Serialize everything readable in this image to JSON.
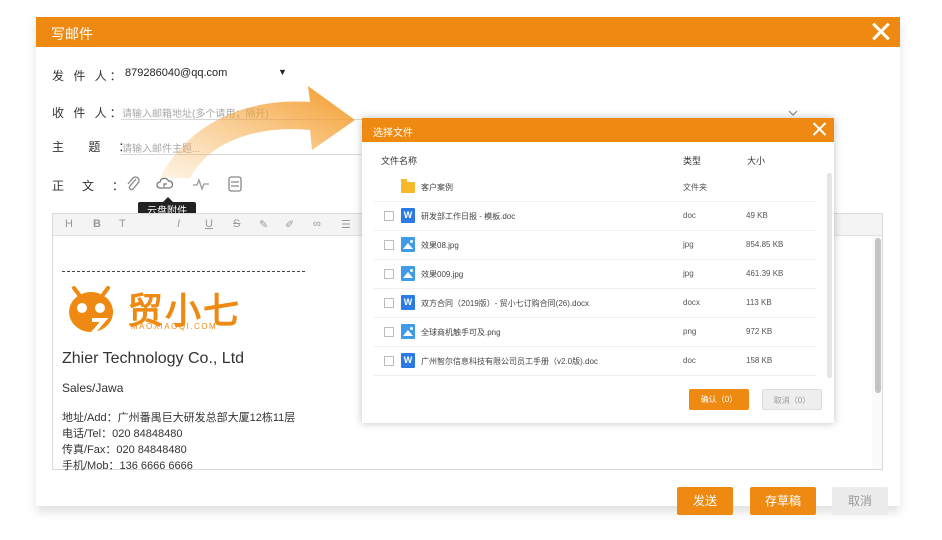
{
  "window": {
    "title": "写邮件"
  },
  "form": {
    "from_label": "发 件 人：",
    "from_value": "879286040@qq.com",
    "to_label": "收 件 人：",
    "to_placeholder": "请输入邮箱地址(多个请用；隔开)",
    "subject_label": "主　 题　：",
    "subject_placeholder": "请输入邮件主题...",
    "body_label": "正　文　：",
    "tooltip": "云盘附件"
  },
  "toolbar_icons": [
    "paperclip-icon",
    "cloud-icon",
    "signature-icon",
    "template-icon"
  ],
  "format_bar": [
    "H",
    "B",
    "T",
    "I",
    "U",
    "S"
  ],
  "signature": {
    "logo_text": "贸小七",
    "logo_sub": "MAOXIAOQI.COM",
    "company": "Zhier Technology Co., Ltd",
    "role": "Sales/Jawa",
    "address": "地址/Add：广州番禺巨大研发总部大厦12栋11层",
    "tel": "电话/Tel：020 84848480",
    "fax": "传真/Fax：020 84848480",
    "mobile": "手机/Mob：136 6666 6666"
  },
  "actions": {
    "send": "发送",
    "draft": "存草稿",
    "cancel": "取消"
  },
  "dialog": {
    "title": "选择文件",
    "col_name": "文件名称",
    "col_type": "类型",
    "col_size": "大小",
    "files": [
      {
        "name": "客户案例",
        "type": "文件夹",
        "size": "",
        "icon": "folder"
      },
      {
        "name": "研发部工作日报 - 模板.doc",
        "type": "doc",
        "size": "49 KB",
        "icon": "word"
      },
      {
        "name": "效果08.jpg",
        "type": "jpg",
        "size": "854.85 KB",
        "icon": "img"
      },
      {
        "name": "效果009.jpg",
        "type": "jpg",
        "size": "461.39 KB",
        "icon": "img"
      },
      {
        "name": "双方合同（2019版）- 贸小七订购合同(26).docx",
        "type": "docx",
        "size": "113 KB",
        "icon": "word"
      },
      {
        "name": "全球商机触手可及.png",
        "type": "png",
        "size": "972 KB",
        "icon": "img"
      },
      {
        "name": "广州智尔信息科技有限公司员工手册（v2.0版).doc",
        "type": "doc",
        "size": "158 KB",
        "icon": "word"
      }
    ],
    "confirm": "确认（0）",
    "cancel": "取消（0）"
  },
  "colors": {
    "accent": "#ee8a12"
  }
}
